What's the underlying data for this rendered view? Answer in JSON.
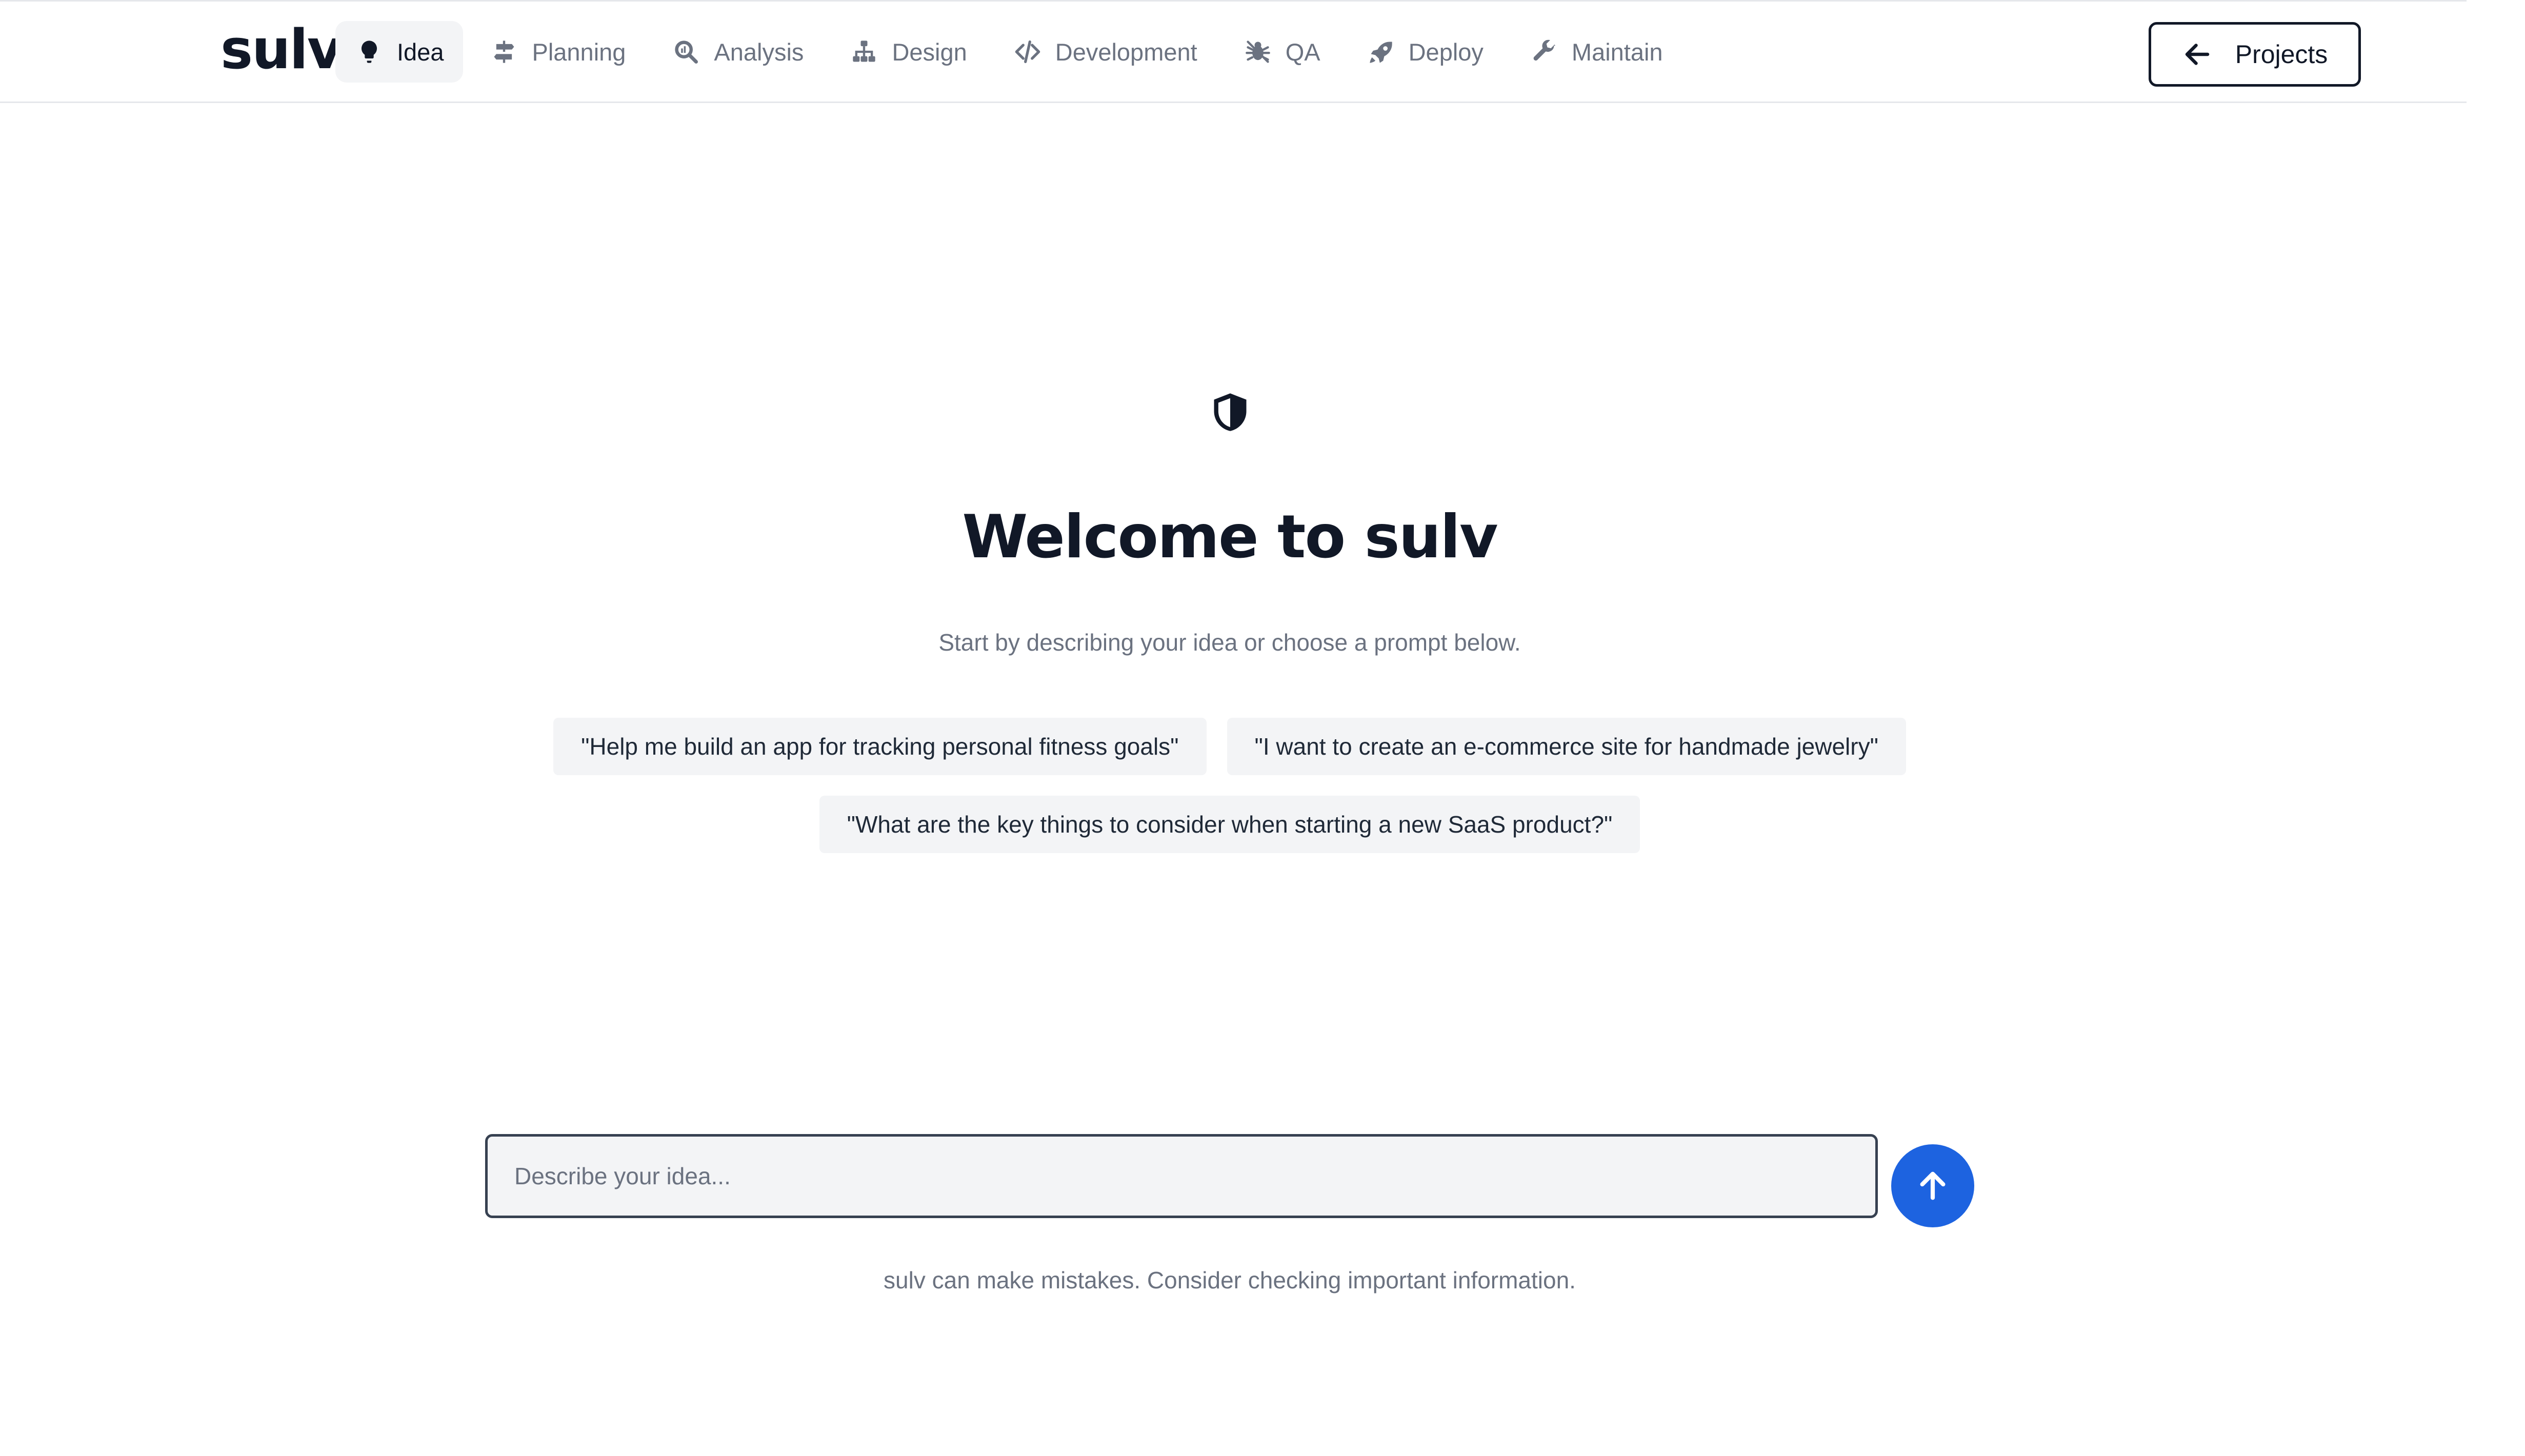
{
  "app": {
    "logo_text": "sulv"
  },
  "nav": {
    "items": [
      {
        "label": "Idea",
        "icon": "lightbulb-icon",
        "active": true
      },
      {
        "label": "Planning",
        "icon": "signpost-icon",
        "active": false
      },
      {
        "label": "Analysis",
        "icon": "magnifier-icon",
        "active": false
      },
      {
        "label": "Design",
        "icon": "sitemap-icon",
        "active": false
      },
      {
        "label": "Development",
        "icon": "code-icon",
        "active": false
      },
      {
        "label": "QA",
        "icon": "bug-icon",
        "active": false
      },
      {
        "label": "Deploy",
        "icon": "rocket-icon",
        "active": false
      },
      {
        "label": "Maintain",
        "icon": "wrench-icon",
        "active": false
      }
    ]
  },
  "header": {
    "projects_label": "Projects"
  },
  "hero": {
    "icon": "shield-icon",
    "title": "Welcome to sulv",
    "subtitle": "Start by describing your idea or choose a prompt below."
  },
  "prompts": [
    "\"Help me build an app for tracking personal fitness goals\"",
    "\"I want to create an e-commerce site for handmade jewelry\"",
    "\"What are the key things to consider when starting a new SaaS product?\""
  ],
  "composer": {
    "placeholder": "Describe your idea...",
    "value": ""
  },
  "footer": {
    "disclaimer": "sulv can make mistakes. Consider checking important information."
  },
  "colors": {
    "accent": "#1d63e0",
    "text_primary": "#111827",
    "text_muted": "#6b7280",
    "chip_bg": "#f3f4f6"
  }
}
